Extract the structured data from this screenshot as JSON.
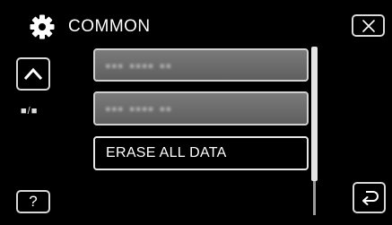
{
  "header": {
    "title": "COMMON",
    "icon": "gear-icon"
  },
  "controls": {
    "close_icon": "close-icon",
    "up_icon": "chevron-up-icon",
    "page_indicator": "■/■",
    "help_label": "?",
    "back_icon": "return-arrow-icon"
  },
  "menu": {
    "items": [
      {
        "label": "▪▪▪ ▪▪▪▪ ▪▪",
        "obscured": true
      },
      {
        "label": "▪▪▪ ▪▪▪▪ ▪▪",
        "obscured": true
      },
      {
        "label": "ERASE ALL DATA",
        "obscured": false
      }
    ]
  },
  "scrollbar": {
    "visible_fraction": 0.8,
    "position": 0
  }
}
